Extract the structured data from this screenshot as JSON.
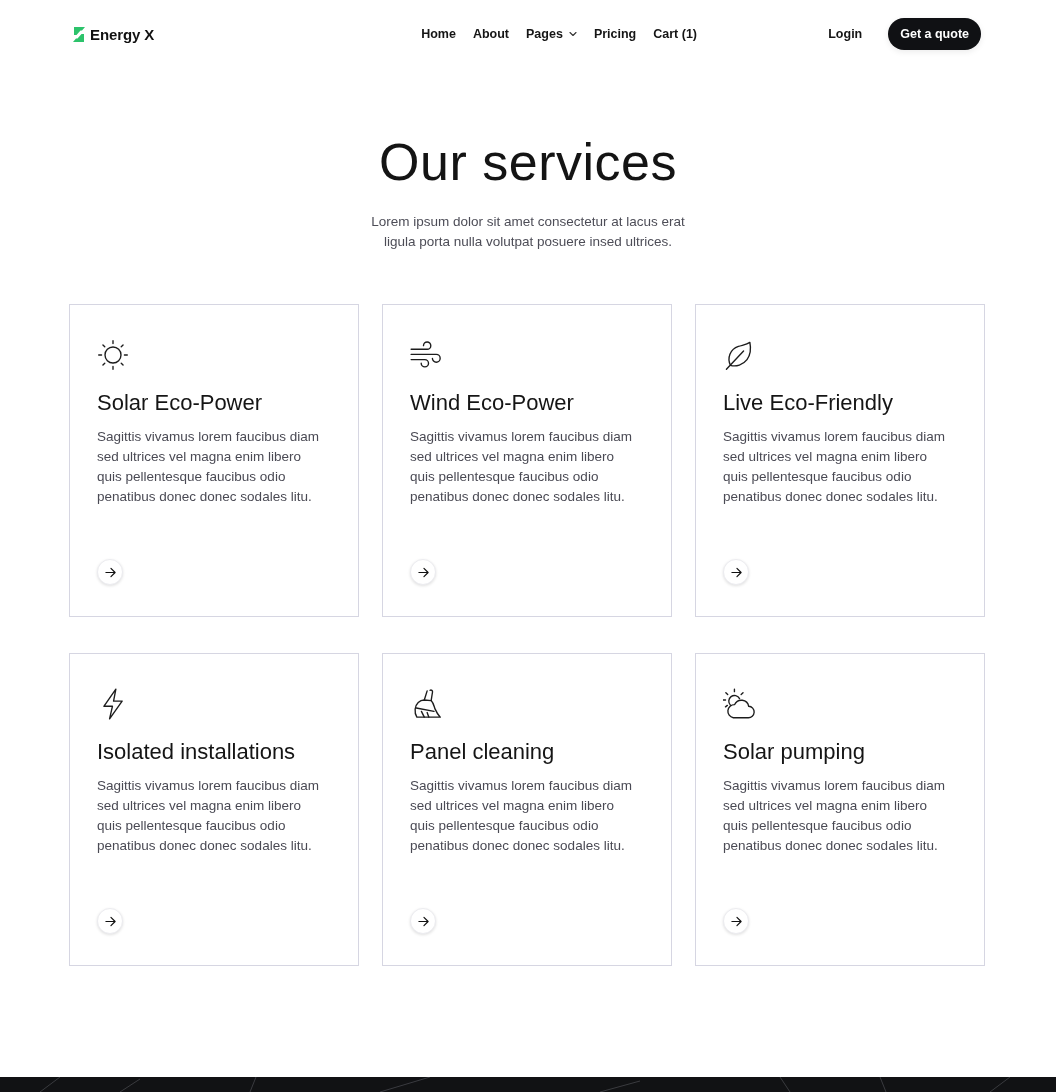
{
  "header": {
    "logo": "Energy X",
    "nav": [
      {
        "label": "Home",
        "kind": "link"
      },
      {
        "label": "About",
        "kind": "link"
      },
      {
        "label": "Pages",
        "kind": "menu"
      },
      {
        "label": "Pricing",
        "kind": "link"
      },
      {
        "label": "Cart (1)",
        "kind": "link"
      }
    ],
    "login": "Login",
    "cta": "Get a quote"
  },
  "intro": {
    "title": "Our services",
    "subtitle": "Lorem ipsum dolor sit amet consectetur at lacus erat ligula porta nulla volutpat posuere insed ultrices."
  },
  "services": [
    {
      "title": "Solar Eco-Power",
      "description": "Sagittis vivamus lorem faucibus diam sed ultrices vel magna enim libero quis pellentesque faucibus odio penatibus donec donec sodales litu."
    },
    {
      "title": "Wind Eco-Power",
      "description": "Sagittis vivamus lorem faucibus diam sed ultrices vel magna enim libero quis pellentesque faucibus odio penatibus donec donec sodales litu."
    },
    {
      "title": "Live Eco-Friendly",
      "description": "Sagittis vivamus lorem faucibus diam sed ultrices vel magna enim libero quis pellentesque faucibus odio penatibus donec donec sodales litu."
    },
    {
      "title": "Isolated installations",
      "description": "Sagittis vivamus lorem faucibus diam sed ultrices vel magna enim libero quis pellentesque faucibus odio penatibus donec donec sodales litu."
    },
    {
      "title": "Panel cleaning",
      "description": "Sagittis vivamus lorem faucibus diam sed ultrices vel magna enim libero quis pellentesque faucibus odio penatibus donec donec sodales litu."
    },
    {
      "title": "Solar pumping",
      "description": "Sagittis vivamus lorem faucibus diam sed ultrices vel magna enim libero quis pellentesque faucibus odio penatibus donec donec sodales litu."
    }
  ]
}
